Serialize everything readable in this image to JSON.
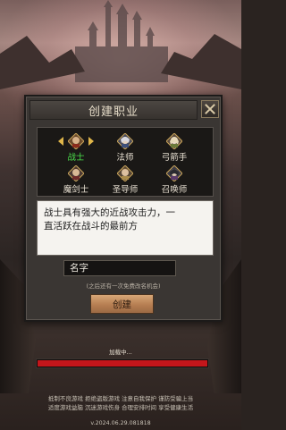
{
  "dialog": {
    "title": "创建职业",
    "close_icon": "close-x-icon"
  },
  "classes": [
    {
      "label": "战士",
      "icon": "warrior-portrait-icon",
      "selected": true
    },
    {
      "label": "法师",
      "icon": "mage-portrait-icon",
      "selected": false
    },
    {
      "label": "弓箭手",
      "icon": "archer-portrait-icon",
      "selected": false
    },
    {
      "label": "魔剑士",
      "icon": "magic-swordsman-portrait-icon",
      "selected": false
    },
    {
      "label": "圣导师",
      "icon": "holy-mentor-portrait-icon",
      "selected": false
    },
    {
      "label": "召唤师",
      "icon": "summoner-portrait-icon",
      "selected": false
    }
  ],
  "description": {
    "line1": "战士具有强大的近战攻击力，一",
    "line2": "直活跃在战斗的最前方"
  },
  "name_input": {
    "value": "名字"
  },
  "rename_note": "(之后还有一次免费改名机会)",
  "create_button": {
    "label": "创建"
  },
  "loading": {
    "text": "加载中...",
    "progress": 1.0
  },
  "notice": {
    "line1": "抵制不良游戏 拒绝盗版游戏 注意自我保护 谨防受骗上当",
    "line2": "适度游戏益脑 沉迷游戏伤身 合理安排时间 享受健康生活"
  },
  "version": "v.2024.06.29.081818",
  "colors": {
    "selected_label": "#4be04b",
    "progress_fill": "#c3161b",
    "create_button": "#c48b5c"
  }
}
